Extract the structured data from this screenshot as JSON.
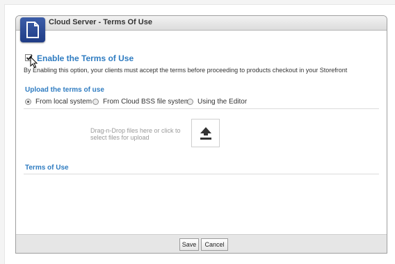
{
  "dialog": {
    "title": "Cloud Server - Terms Of Use",
    "app_icon": "document-icon"
  },
  "enable_terms": {
    "checked": true,
    "label": "Enable the Terms of Use",
    "description": "By Enabling this option, your clients must accept the terms before proceeding to products checkout in your Storefront"
  },
  "upload": {
    "section_title": "Upload the terms of use",
    "options": [
      {
        "label": "From local system",
        "selected": true
      },
      {
        "label": "From Cloud BSS file system",
        "selected": false
      },
      {
        "label": "Using the Editor",
        "selected": false
      }
    ],
    "dropzone_text": "Drag-n-Drop files here or click to select files for upload",
    "upload_icon": "upload-icon"
  },
  "terms": {
    "section_title": "Terms of Use"
  },
  "footer": {
    "save_label": "Save",
    "cancel_label": "Cancel"
  },
  "colors": {
    "accent": "#2f7cc1",
    "icon_bg": "#2a4a96"
  }
}
